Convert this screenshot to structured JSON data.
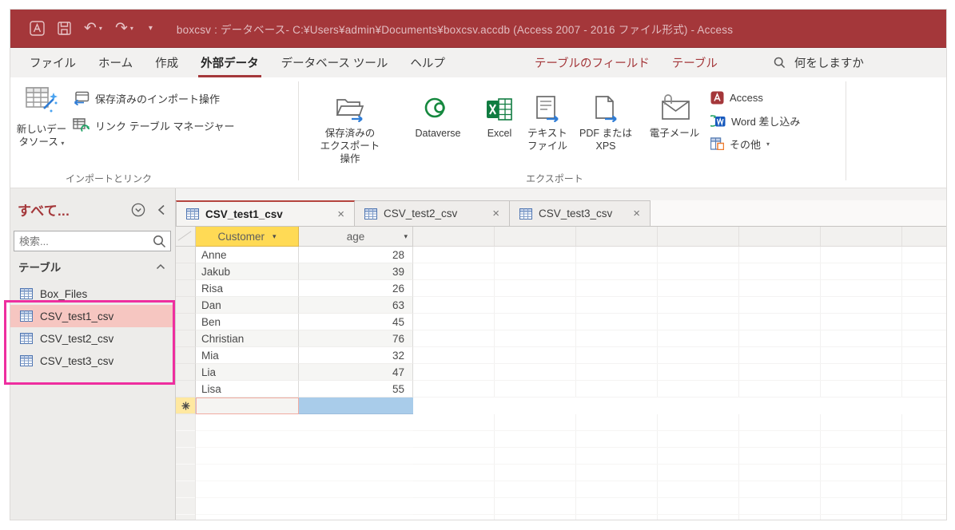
{
  "title_bar": {
    "title": "boxcsv : データベース- C:¥Users¥admin¥Documents¥boxcsv.accdb (Access 2007 - 2016 ファイル形式)  -  Access"
  },
  "menu": {
    "tabs": [
      {
        "label": "ファイル",
        "active": false,
        "contextual": false
      },
      {
        "label": "ホーム",
        "active": false,
        "contextual": false
      },
      {
        "label": "作成",
        "active": false,
        "contextual": false
      },
      {
        "label": "外部データ",
        "active": true,
        "contextual": false
      },
      {
        "label": "データベース ツール",
        "active": false,
        "contextual": false
      },
      {
        "label": "ヘルプ",
        "active": false,
        "contextual": false
      },
      {
        "label": "テーブルのフィールド",
        "active": false,
        "contextual": true
      },
      {
        "label": "テーブル",
        "active": false,
        "contextual": true
      }
    ],
    "search_label": "何をしますか"
  },
  "ribbon": {
    "import_group": {
      "new_data_source_l1": "新しいデー",
      "new_data_source_l2": "タソース",
      "saved_imports": "保存済みのインポート操作",
      "linked_table_manager": "リンク テーブル マネージャー",
      "group_label": "インポートとリンク"
    },
    "export_group": {
      "saved_exports_l1": "保存済みの",
      "saved_exports_l2": "エクスポート操作",
      "dataverse": "Dataverse",
      "excel": "Excel",
      "text_file_l1": "テキスト",
      "text_file_l2": "ファイル",
      "pdf_l1": "PDF または",
      "pdf_l2": "XPS",
      "email": "電子メール",
      "access": "Access",
      "word_merge": "Word 差し込み",
      "more": "その他",
      "group_label": "エクスポート"
    }
  },
  "nav_pane": {
    "title": "すべて...",
    "search_placeholder": "検索...",
    "section": "テーブル",
    "items": [
      {
        "label": "Box_Files",
        "selected": false
      },
      {
        "label": "CSV_test1_csv",
        "selected": true
      },
      {
        "label": "CSV_test2_csv",
        "selected": false
      },
      {
        "label": "CSV_test3_csv",
        "selected": false
      }
    ]
  },
  "document_tabs": [
    {
      "label": "CSV_test1_csv",
      "active": true
    },
    {
      "label": "CSV_test2_csv",
      "active": false
    },
    {
      "label": "CSV_test3_csv",
      "active": false
    }
  ],
  "datasheet": {
    "columns": [
      "Customer",
      "age"
    ],
    "rows": [
      [
        "Anne",
        28
      ],
      [
        "Jakub",
        39
      ],
      [
        "Risa",
        26
      ],
      [
        "Dan",
        63
      ],
      [
        "Ben",
        45
      ],
      [
        "Christian",
        76
      ],
      [
        "Mia",
        32
      ],
      [
        "Lia",
        47
      ],
      [
        "Lisa",
        55
      ]
    ]
  },
  "colors": {
    "titlebar": "#A4373A",
    "accent_red": "#A4373A",
    "selected_nav_bg": "#F6C6C1",
    "selected_header_bg": "#FFDA55",
    "new_row_cell_blue": "#A9CCEA",
    "annotation_pink": "#EE2E9F"
  }
}
